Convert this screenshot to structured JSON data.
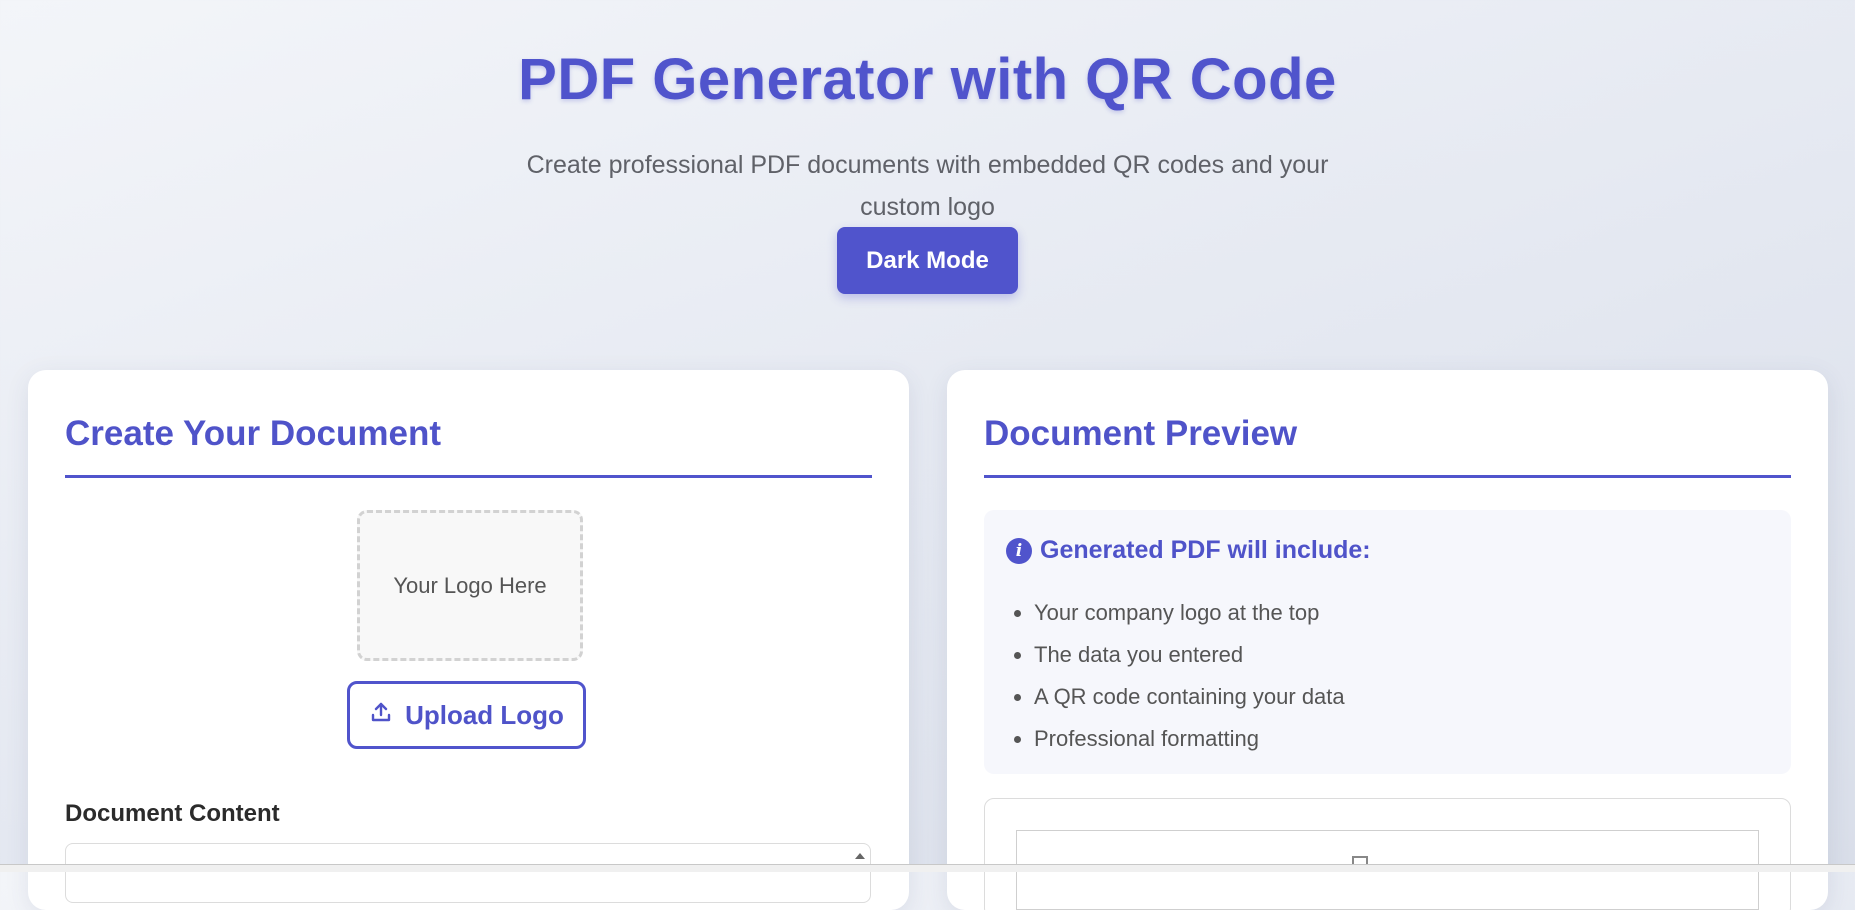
{
  "header": {
    "title": "PDF Generator with QR Code",
    "subtitle": "Create professional PDF documents with embedded QR codes and your custom logo",
    "dark_mode_label": "Dark Mode"
  },
  "create_card": {
    "title": "Create Your Document",
    "logo_placeholder": "Your Logo Here",
    "upload_label": "Upload Logo",
    "content_label": "Document Content",
    "content_value": ""
  },
  "preview_card": {
    "title": "Document Preview",
    "info_title": "Generated PDF will include:",
    "items": [
      "Your company logo at the top",
      "The data you entered",
      "A QR code containing your data",
      "Professional formatting"
    ]
  },
  "icons": {
    "info": "info-icon",
    "upload": "upload-icon",
    "document": "document-icon"
  },
  "colors": {
    "accent": "#5054cc",
    "background": "#e4e8f1"
  }
}
